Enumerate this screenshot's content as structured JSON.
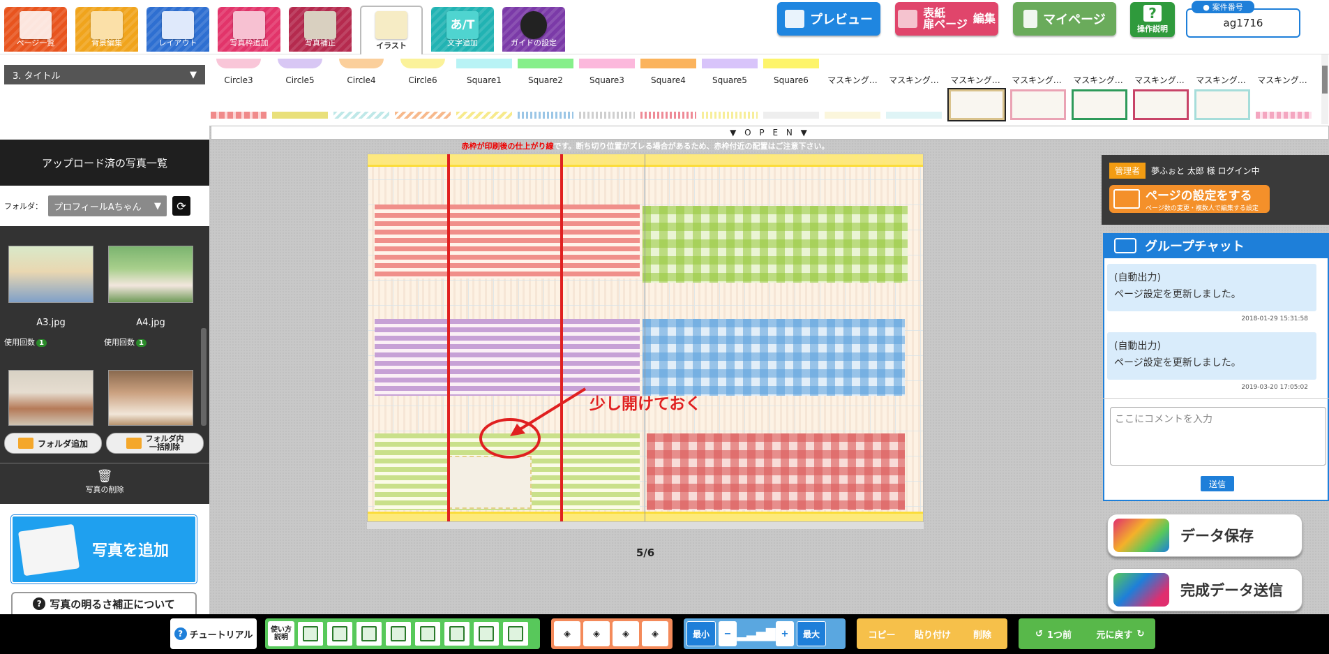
{
  "toolbar": {
    "tools": [
      {
        "label": "ページ一覧",
        "color": "#e8541e"
      },
      {
        "label": "背景編集",
        "color": "#f0a41c"
      },
      {
        "label": "レイアウト",
        "color": "#2e6fd1"
      },
      {
        "label": "写真枠追加",
        "color": "#e2346a"
      },
      {
        "label": "写真補正",
        "color": "#b52a4e"
      },
      {
        "label": "イラスト",
        "color": "#ffffff"
      },
      {
        "label": "文字追加",
        "color": "#21b3b3"
      },
      {
        "label": "ガイドの設定",
        "color": "#7b3aa8"
      }
    ]
  },
  "header": {
    "preview": "プレビュー",
    "cover_edit_line1": "表紙",
    "cover_edit_line2": "扉ページ",
    "cover_edit_suffix": "編集",
    "mypage": "マイページ",
    "help_line1": "?",
    "help_line2": "操作説明",
    "case_label": "案件番号",
    "case_id": "ag1716"
  },
  "section": {
    "selected": "3. タイトル"
  },
  "illustrations": {
    "row1": [
      "Circle3",
      "Circle5",
      "Circle4",
      "Circle6",
      "Square1",
      "Square2",
      "Square3",
      "Square4",
      "Square5",
      "Square6",
      "マスキング…",
      "マスキング…",
      "マスキング…",
      "マスキング…",
      "マスキング…",
      "マスキング…",
      "マスキング…",
      "マスキング…"
    ]
  },
  "open_bar": "▼ O P E N ▼",
  "left": {
    "title": "アップロード済の写真一覧",
    "folder_label": "フォルダ：",
    "folder_value": "プロフィールAちゃん",
    "photos": [
      {
        "name": "A3.jpg",
        "use_label": "使用回数",
        "use_count": "1"
      },
      {
        "name": "A4.jpg",
        "use_label": "使用回数",
        "use_count": "1"
      }
    ],
    "add_folder": "フォルダ追加",
    "delete_folder_line1": "フォルダ内",
    "delete_folder_line2": "一括削除",
    "delete_photo": "写真の削除",
    "add_photo": "写真を追加",
    "brightness": "写真の明るさ補正について"
  },
  "canvas": {
    "warning_red": "赤枠が印刷後の仕上がり線",
    "warning_rest": "です。断ち切り位置がズレる場合があるため、赤枠付近の配置はご注意下さい。",
    "annotation": "少し開けておく",
    "page": "5/6"
  },
  "right": {
    "admin": "管理者",
    "login": "夢ふぉと 太郎 様 ログイン中",
    "settings_title": "ページの設定をする",
    "settings_sub": "ページ数の変更・複数人で編集する設定",
    "chat_title": "グループチャット",
    "messages": [
      {
        "l1": "(自動出力)",
        "l2": "ページ設定を更新しました。",
        "ts": "2018-01-29 15:31:58"
      },
      {
        "l1": "(自動出力)",
        "l2": "ページ設定を更新しました。",
        "ts": "2019-03-20 17:05:02"
      }
    ],
    "comment_placeholder": "ここにコメントを入力",
    "send": "送信",
    "save": "データ保存",
    "submit": "完成データ送信"
  },
  "bottom": {
    "tutorial": "チュートリアル",
    "howto_line1": "使い方",
    "howto_line2": "説明",
    "min": "最小",
    "max": "最大",
    "copy": "コピー",
    "paste": "貼り付け",
    "delete": "削除",
    "undo": "1つ前",
    "redo": "元に戻す"
  },
  "colors": {
    "accent_blue": "#1e7fd9",
    "orange": "#f39c12",
    "green_toolbar": "#58c85b",
    "red_guide": "#e02020"
  }
}
